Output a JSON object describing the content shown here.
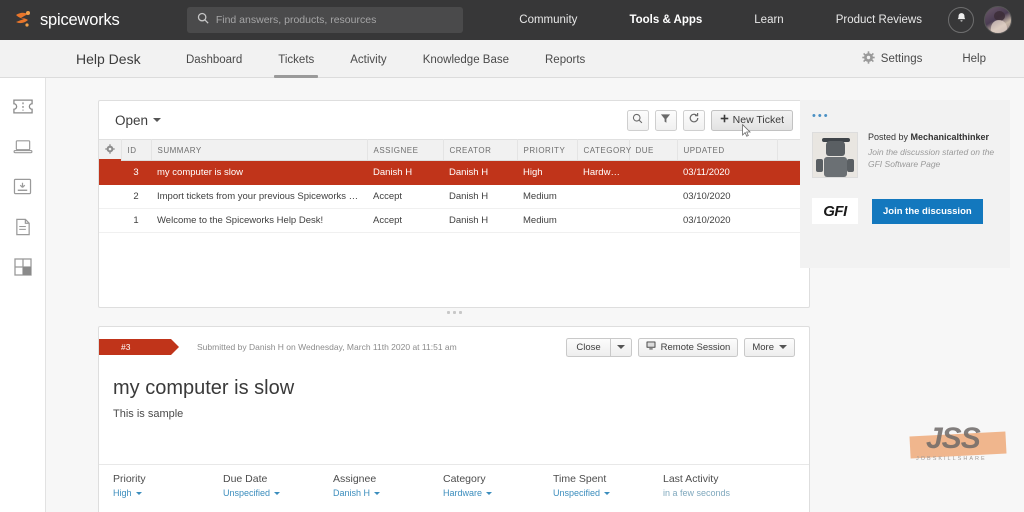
{
  "topbar": {
    "brand": "spiceworks",
    "search": {
      "placeholder": "Find answers, products, resources",
      "value": ""
    },
    "nav": [
      {
        "label": "Community",
        "bold": false
      },
      {
        "label": "Tools & Apps",
        "bold": true
      },
      {
        "label": "Learn",
        "bold": false
      },
      {
        "label": "Product Reviews",
        "bold": false
      }
    ],
    "bell_icon": "bell-icon",
    "avatar_icon": "user-avatar"
  },
  "subnav": {
    "title": "Help Desk",
    "tabs": [
      {
        "label": "Dashboard",
        "active": false
      },
      {
        "label": "Tickets",
        "active": true
      },
      {
        "label": "Activity",
        "active": false
      },
      {
        "label": "Knowledge Base",
        "active": false
      },
      {
        "label": "Reports",
        "active": false
      }
    ],
    "settings_label": "Settings",
    "help_label": "Help",
    "gear_icon": "gear-icon"
  },
  "rail": [
    {
      "icon": "ticket-icon",
      "active": true
    },
    {
      "icon": "laptop-icon",
      "active": false
    },
    {
      "icon": "inbox-icon",
      "active": false
    },
    {
      "icon": "document-icon",
      "active": false
    },
    {
      "icon": "grid-icon",
      "active": false
    }
  ],
  "ticket_panel": {
    "filter_label": "Open",
    "search_icon": "search-icon",
    "filter_icon": "filter-icon",
    "refresh_icon": "refresh-icon",
    "new_ticket_label": "New Ticket",
    "columns": [
      "ID",
      "SUMMARY",
      "ASSIGNEE",
      "CREATOR",
      "PRIORITY",
      "CATEGORY",
      "DUE",
      "UPDATED"
    ],
    "rows": [
      {
        "id": "3",
        "summary": "my computer is slow",
        "assignee": "Danish H",
        "assignee_link": false,
        "creator": "Danish H",
        "priority": "High",
        "category": "Hardware",
        "due": "",
        "updated": "03/11/2020",
        "selected": true
      },
      {
        "id": "2",
        "summary": "Import tickets from your previous Spiceworks Help ...",
        "assignee": "Accept",
        "assignee_link": true,
        "creator": "Danish H",
        "priority": "Medium",
        "category": "",
        "due": "",
        "updated": "03/10/2020",
        "selected": false
      },
      {
        "id": "1",
        "summary": "Welcome to the Spiceworks Help Desk!",
        "assignee": "Accept",
        "assignee_link": true,
        "creator": "Danish H",
        "priority": "Medium",
        "category": "",
        "due": "",
        "updated": "03/10/2020",
        "selected": false
      }
    ]
  },
  "detail": {
    "tag": "#3",
    "submitted": "Submitted by Danish H on Wednesday, March 11th 2020 at 11:51 am",
    "close_label": "Close",
    "remote_label": "Remote Session",
    "more_label": "More",
    "title": "my computer is slow",
    "body": "This is sample",
    "meta": [
      {
        "label": "Priority",
        "value": "High",
        "dropdown": true
      },
      {
        "label": "Due Date",
        "value": "Unspecified",
        "dropdown": true
      },
      {
        "label": "Assignee",
        "value": "Danish H",
        "dropdown": true
      },
      {
        "label": "Category",
        "value": "Hardware",
        "dropdown": true
      },
      {
        "label": "Time Spent",
        "value": "Unspecified",
        "dropdown": true
      },
      {
        "label": "Last Activity",
        "value": "in a few seconds",
        "dropdown": false
      }
    ]
  },
  "sidebar": {
    "dots": "•••",
    "posted_prefix": "Posted by ",
    "posted_author": "Mechanicalthinker",
    "promo_text": "Join the discussion started on the GFI Software Page",
    "brand_logo": "GFI",
    "cta_label": "Join the discussion"
  },
  "watermark": {
    "text": "JSS",
    "sub": "JOBSKILLSHARE"
  },
  "colors": {
    "topbar_bg": "#373738",
    "accent_red": "#c0341a",
    "accent_orange": "#e8752a",
    "link_blue": "#3b8dbd",
    "cta_blue": "#1378be"
  }
}
